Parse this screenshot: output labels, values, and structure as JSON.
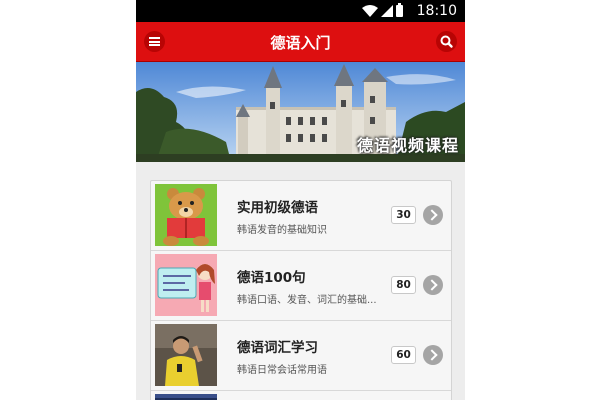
{
  "status_bar": {
    "time": "18:10"
  },
  "app_bar": {
    "title": "德语入门"
  },
  "banner": {
    "caption": "德语视频课程"
  },
  "courses": [
    {
      "title": "实用初级德语",
      "subtitle": "韩语发音的基础知识",
      "count": "30"
    },
    {
      "title": "德语100句",
      "subtitle": "韩语口语、发音、词汇的基础...",
      "count": "80"
    },
    {
      "title": "德语词汇学习",
      "subtitle": "韩语日常会话常用语",
      "count": "60"
    }
  ],
  "colors": {
    "app_bar": "#dd0f10",
    "status_bar": "#000000",
    "chevron": "#a5a5a5"
  },
  "icons": [
    "menu-icon",
    "search-icon",
    "wifi-icon",
    "signal-icon",
    "battery-icon",
    "chevron-right-icon"
  ]
}
